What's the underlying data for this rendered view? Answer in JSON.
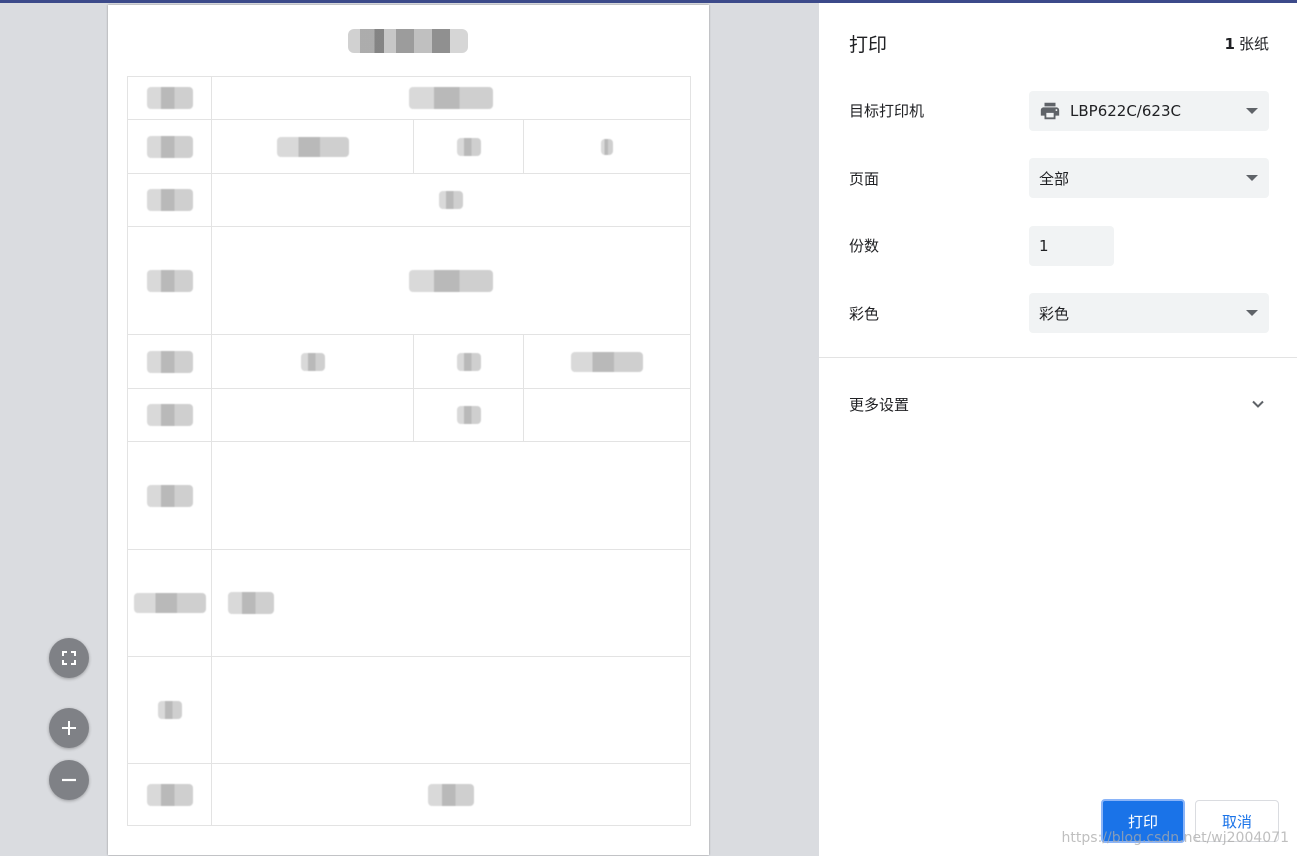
{
  "dialog": {
    "title": "打印",
    "sheet_count": "1",
    "sheet_unit": "张纸"
  },
  "settings": {
    "printer": {
      "label": "目标打印机",
      "value": "LBP622C/623C"
    },
    "pages": {
      "label": "页面",
      "value": "全部"
    },
    "copies": {
      "label": "份数",
      "value": "1"
    },
    "color": {
      "label": "彩色",
      "value": "彩色"
    },
    "more": {
      "label": "更多设置"
    }
  },
  "buttons": {
    "print": "打印",
    "cancel": "取消"
  },
  "watermark": "https://blog.csdn.net/wj2004071",
  "colors": {
    "accent": "#1a73e8",
    "preview_bg": "#dadce0",
    "field_bg": "#f1f3f4"
  },
  "icons": {
    "printer": "printer-icon",
    "fit": "fit-to-page-icon",
    "zoom_in": "plus-icon",
    "zoom_out": "minus-icon",
    "expand": "chevron-down-icon",
    "dropdown": "caret-down-icon"
  }
}
